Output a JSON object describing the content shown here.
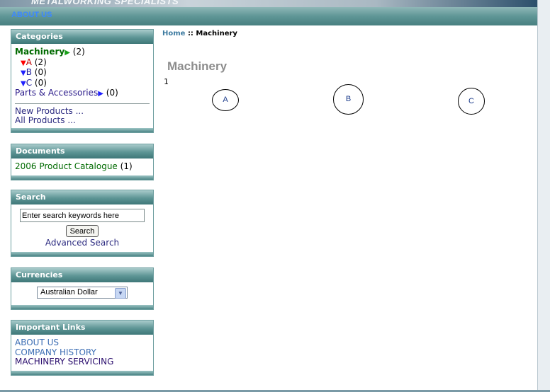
{
  "header": {
    "tagline": "METALWORKING SPECIALISTS",
    "nav_link": "ABOUT US"
  },
  "sidebar": {
    "categories": {
      "title": "Categories",
      "main": {
        "label": "Machinery",
        "count": "(2)"
      },
      "subs": [
        {
          "label": "A",
          "count": "(2)"
        },
        {
          "label": "B",
          "count": "(0)"
        },
        {
          "label": "C",
          "count": "(0)"
        }
      ],
      "parts": {
        "label": "Parts & Accessories",
        "count": "(0)"
      },
      "new_products": "New Products ...",
      "all_products": "All Products ..."
    },
    "documents": {
      "title": "Documents",
      "item": {
        "label": "2006 Product Catalogue",
        "count": "(1)"
      }
    },
    "search": {
      "title": "Search",
      "input_value": "Enter search keywords here",
      "button": "Search",
      "advanced": "Advanced Search"
    },
    "currencies": {
      "title": "Currencies",
      "selected": "Australian Dollar"
    },
    "links": {
      "title": "Important Links",
      "items": [
        "ABOUT US",
        "COMPANY HISTORY",
        "MACHINERY SERVICING"
      ]
    }
  },
  "main": {
    "breadcrumb": {
      "home": "Home",
      "separator": "::",
      "current": "Machinery"
    },
    "title": "Machinery",
    "count": "1",
    "subcategories": [
      "A",
      "B",
      "C"
    ]
  },
  "colors": {
    "accent_teal": "#5d9595",
    "category_green": "#006a00",
    "link_blue": "#3c6eb4"
  }
}
